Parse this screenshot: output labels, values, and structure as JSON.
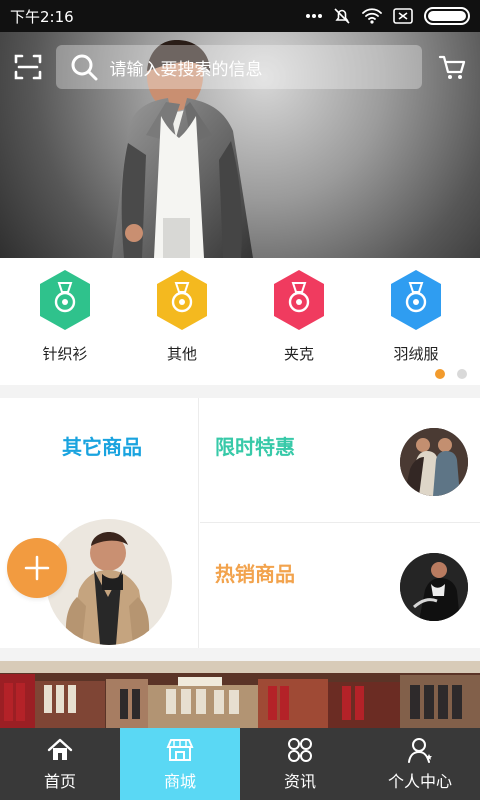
{
  "status_bar": {
    "time": "下午2:16",
    "icons": [
      "more-dots",
      "mute-bell",
      "wifi",
      "sim-off",
      "battery"
    ]
  },
  "search": {
    "placeholder": "请输入要搜索的信息"
  },
  "categories": [
    {
      "label": "针织衫",
      "color": "#2fc28c",
      "icon": "medal-icon"
    },
    {
      "label": "其他",
      "color": "#f4b91f",
      "icon": "medal-icon"
    },
    {
      "label": "夹克",
      "color": "#f03b5f",
      "icon": "medal-icon"
    },
    {
      "label": "羽绒服",
      "color": "#2f9df1",
      "icon": "medal-icon"
    }
  ],
  "pager": {
    "active_color": "#f29b2d",
    "inactive_color": "#d9d9d9"
  },
  "sections": {
    "other_goods": "其它商品",
    "limited_offer": "限时特惠",
    "hot_goods": "热销商品"
  },
  "bottom_nav": [
    {
      "label": "首页",
      "icon": "home-icon"
    },
    {
      "label": "商城",
      "icon": "store-icon"
    },
    {
      "label": "资讯",
      "icon": "grid-icon"
    },
    {
      "label": "个人中心",
      "icon": "user-icon"
    }
  ],
  "colors": {
    "status_bar": "#111111",
    "bottom_nav": "#393939",
    "bottom_nav_active": "#5ad8f4",
    "other_goods": "#19a3df",
    "limited_offer": "#37c9a8",
    "hot_goods": "#f2a34d",
    "fab": "#f29b40"
  }
}
